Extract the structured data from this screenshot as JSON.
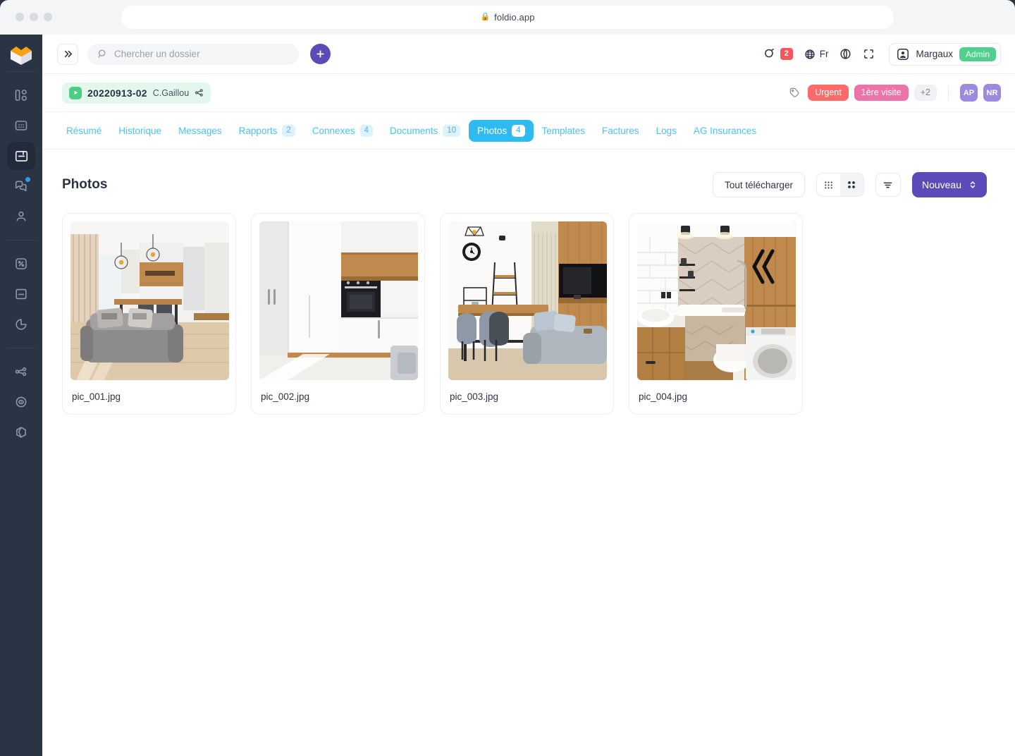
{
  "browser": {
    "url": "foldio.app",
    "lock_icon": "lock-icon",
    "traffic_lights": [
      "close",
      "minimize",
      "maximize"
    ]
  },
  "sidebar": {
    "logo_icon": "open-box-logo",
    "groups": [
      {
        "items": [
          {
            "name": "dashboard-icon",
            "active": false,
            "badge": false
          },
          {
            "name": "calendar-grid-icon",
            "active": false,
            "badge": false
          },
          {
            "name": "folder-file-icon",
            "active": true,
            "badge": false
          },
          {
            "name": "chat-bubbles-icon",
            "active": false,
            "badge": true
          },
          {
            "name": "user-icon",
            "active": false,
            "badge": false
          }
        ]
      },
      {
        "items": [
          {
            "name": "percent-box-icon",
            "active": false,
            "badge": false
          },
          {
            "name": "document-icon",
            "active": false,
            "badge": false
          },
          {
            "name": "pie-chart-icon",
            "active": false,
            "badge": false
          }
        ]
      },
      {
        "items": [
          {
            "name": "share-network-icon",
            "active": false,
            "badge": false
          },
          {
            "name": "target-eye-icon",
            "active": false,
            "badge": false
          },
          {
            "name": "cube-icon",
            "active": false,
            "badge": false
          }
        ]
      }
    ]
  },
  "topbar": {
    "collapse_label": "»",
    "collapse_icon": "chevrons-right-icon",
    "search_placeholder": "Chercher un dossier",
    "search_value": "",
    "search_icon": "search-icon",
    "add_label": "+",
    "notifications": {
      "icon": "notification-bell-icon",
      "count": "2",
      "count_color": "#f4565a"
    },
    "language": {
      "icon": "globe-icon",
      "label": "Fr"
    },
    "help_icon": "help-sphere-icon",
    "fullscreen_icon": "fullscreen-icon",
    "user": {
      "avatar_icon": "user-avatar-icon",
      "name": "Margaux",
      "role": "Admin",
      "role_color": "#51d08d"
    }
  },
  "file_header": {
    "status_icon": "play-icon",
    "status_color": "#4cce85",
    "id": "20220913-02",
    "owner": "C.Gaillou",
    "share_icon": "share-icon",
    "tag_icon": "tag-icon",
    "tags": [
      {
        "label": "Urgent",
        "color": "#fc6a6a"
      },
      {
        "label": "1ère visite",
        "color": "#ec74a8"
      }
    ],
    "tags_more": "+2",
    "assignees": [
      {
        "initials": "AP",
        "color": "#9b8ae0"
      },
      {
        "initials": "NR",
        "color": "#9b8ae0"
      }
    ]
  },
  "tabs": [
    {
      "label": "Résumé",
      "count": null,
      "active": false
    },
    {
      "label": "Historique",
      "count": null,
      "active": false
    },
    {
      "label": "Messages",
      "count": null,
      "active": false
    },
    {
      "label": "Rapports",
      "count": "2",
      "active": false
    },
    {
      "label": "Connexes",
      "count": "4",
      "active": false
    },
    {
      "label": "Documents",
      "count": "10",
      "active": false
    },
    {
      "label": "Photos",
      "count": "4",
      "active": true
    },
    {
      "label": "Templates",
      "count": null,
      "active": false
    },
    {
      "label": "Factures",
      "count": null,
      "active": false
    },
    {
      "label": "Logs",
      "count": null,
      "active": false
    },
    {
      "label": "AG Insurances",
      "count": null,
      "active": false
    }
  ],
  "content": {
    "title": "Photos",
    "download_all_label": "Tout télécharger",
    "view_modes": [
      {
        "name": "list-view-icon",
        "active": false
      },
      {
        "name": "grid-view-icon",
        "active": true
      }
    ],
    "filter_icon": "filter-icon",
    "new_label": "Nouveau",
    "new_icon": "chevron-updown-icon",
    "accent_color": "#5b4bb8",
    "photos": [
      {
        "name": "pic_001.jpg",
        "alt": "open-plan living room with grey sofa and wooden kitchen"
      },
      {
        "name": "pic_002.jpg",
        "alt": "white kitchen cabinets with built-in oven"
      },
      {
        "name": "pic_003.jpg",
        "alt": "dining bar with stools and wall-mounted tv"
      },
      {
        "name": "pic_004.jpg",
        "alt": "bathroom with bathtub, washbasin and washing machine"
      }
    ]
  }
}
